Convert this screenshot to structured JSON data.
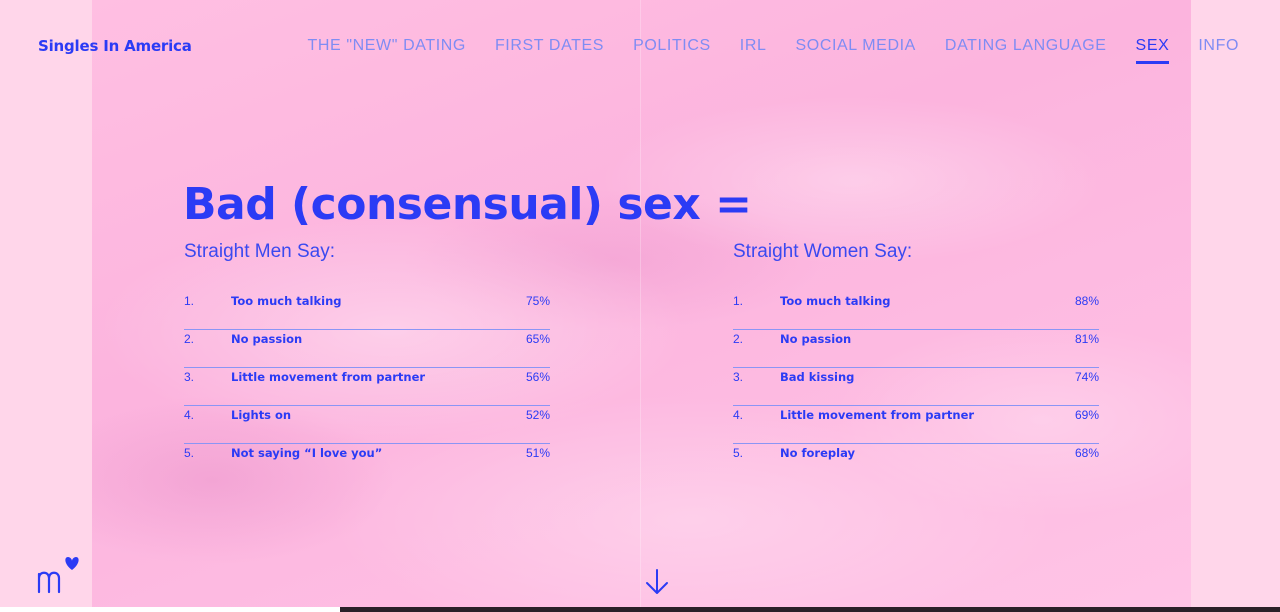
{
  "brand": "Singles In America",
  "nav": [
    {
      "label": "THE \"NEW\" DATING",
      "active": false
    },
    {
      "label": "FIRST DATES",
      "active": false
    },
    {
      "label": "POLITICS",
      "active": false
    },
    {
      "label": "IRL",
      "active": false
    },
    {
      "label": "SOCIAL MEDIA",
      "active": false
    },
    {
      "label": "DATING LANGUAGE",
      "active": false
    },
    {
      "label": "SEX",
      "active": true
    },
    {
      "label": "INFO",
      "active": false
    }
  ],
  "headline": "Bad (consensual) sex =",
  "men": {
    "title": "Straight Men Say:",
    "items": [
      {
        "num": "1.",
        "label": "Too much talking",
        "pct": "75%"
      },
      {
        "num": "2.",
        "label": "No passion",
        "pct": "65%"
      },
      {
        "num": "3.",
        "label": "Little movement from partner",
        "pct": "56%"
      },
      {
        "num": "4.",
        "label": "Lights on",
        "pct": "52%"
      },
      {
        "num": "5.",
        "label": "Not saying “I love you”",
        "pct": "51%"
      }
    ]
  },
  "women": {
    "title": "Straight Women Say:",
    "items": [
      {
        "num": "1.",
        "label": "Too much talking",
        "pct": "88%"
      },
      {
        "num": "2.",
        "label": "No passion",
        "pct": "81%"
      },
      {
        "num": "3.",
        "label": "Bad kissing",
        "pct": "74%"
      },
      {
        "num": "4.",
        "label": "Little movement from partner",
        "pct": "69%"
      },
      {
        "num": "5.",
        "label": "No foreplay",
        "pct": "68%"
      }
    ]
  },
  "icons": {
    "logo": "match-logo-icon",
    "scroll": "arrow-down-icon"
  },
  "colors": {
    "accent": "#2b3bf5",
    "nav_inactive": "#7f8cf3",
    "background": "#ffd6ea",
    "background_center": "#fcb4de"
  }
}
